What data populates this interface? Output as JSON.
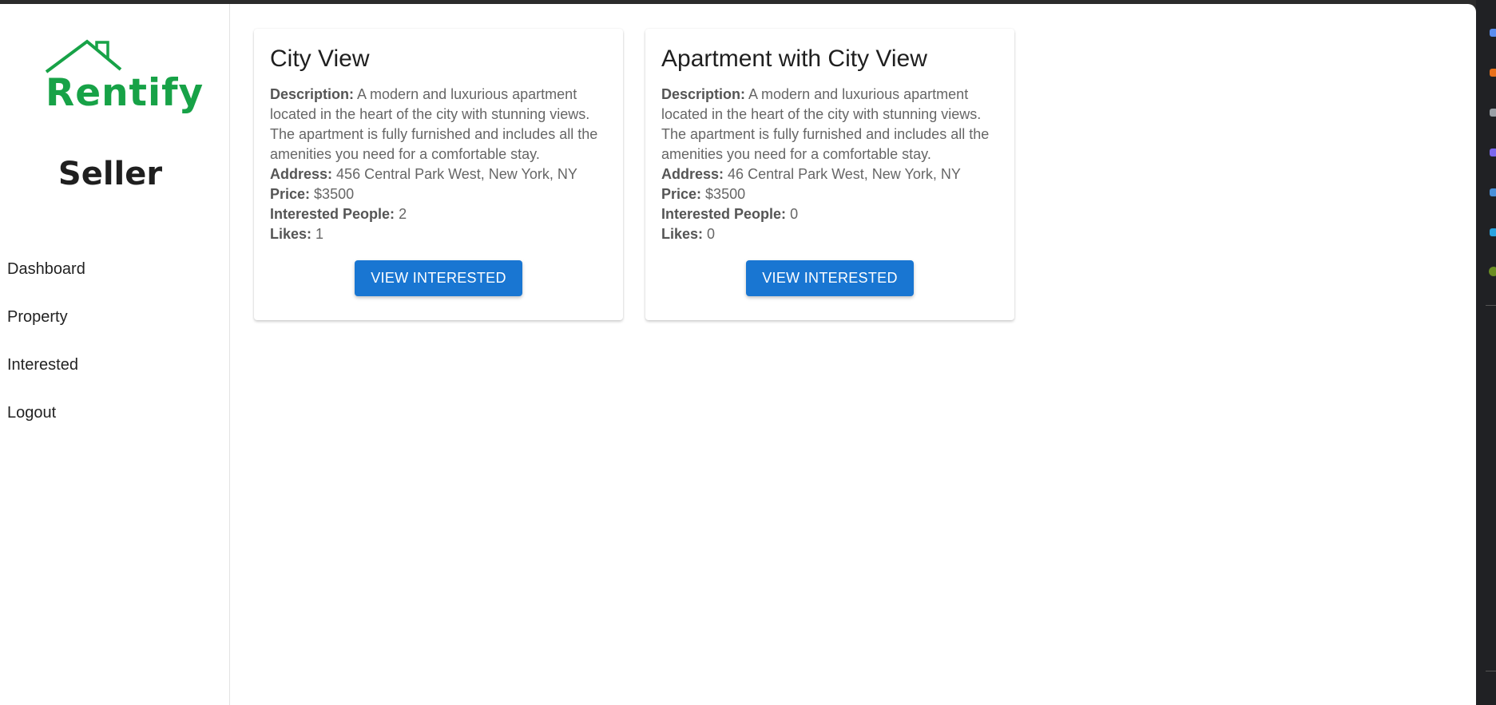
{
  "brand": {
    "logo_text": "Rentify",
    "color": "#17a247"
  },
  "role_title": "Seller",
  "nav": [
    {
      "label": "Dashboard"
    },
    {
      "label": "Property"
    },
    {
      "label": "Interested"
    },
    {
      "label": "Logout"
    }
  ],
  "labels": {
    "description": "Description:",
    "address": "Address:",
    "price": "Price:",
    "interested": "Interested People:",
    "likes": "Likes:",
    "button": "VIEW INTERESTED"
  },
  "properties": [
    {
      "title": "City View",
      "description": "A modern and luxurious apartment located in the heart of the city with stunning views. The apartment is fully furnished and includes all the amenities you need for a comfortable stay.",
      "address": "456 Central Park West, New York, NY",
      "price": "$3500",
      "interested": "2",
      "likes": "1"
    },
    {
      "title": "Apartment with City View",
      "description": "A modern and luxurious apartment located in the heart of the city with stunning views. The apartment is fully furnished and includes all the amenities you need for a comfortable stay.",
      "address": "46 Central Park West, New York, NY",
      "price": "$3500",
      "interested": "0",
      "likes": "0"
    }
  ],
  "colors": {
    "accent": "#1976d2",
    "background": "#ffffff",
    "frame": "#2b2b2b"
  }
}
